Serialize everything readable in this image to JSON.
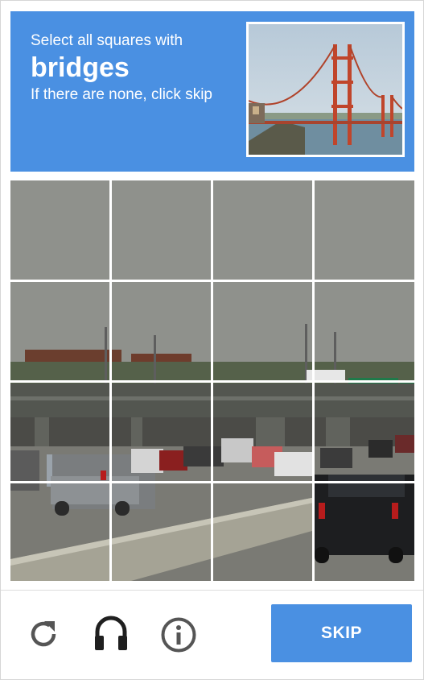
{
  "header": {
    "line1": "Select all squares with",
    "target": "bridges",
    "line2": "If there are none, click skip"
  },
  "example_image": {
    "subject": "Golden Gate Bridge"
  },
  "grid": {
    "rows": 4,
    "cols": 4,
    "scene": "highway traffic with overpass"
  },
  "footer": {
    "reload_icon": "reload-icon",
    "audio_icon": "headphones-icon",
    "info_icon": "info-icon",
    "skip_label": "SKIP"
  },
  "colors": {
    "accent": "#4a90e2",
    "icon": "#555555"
  }
}
